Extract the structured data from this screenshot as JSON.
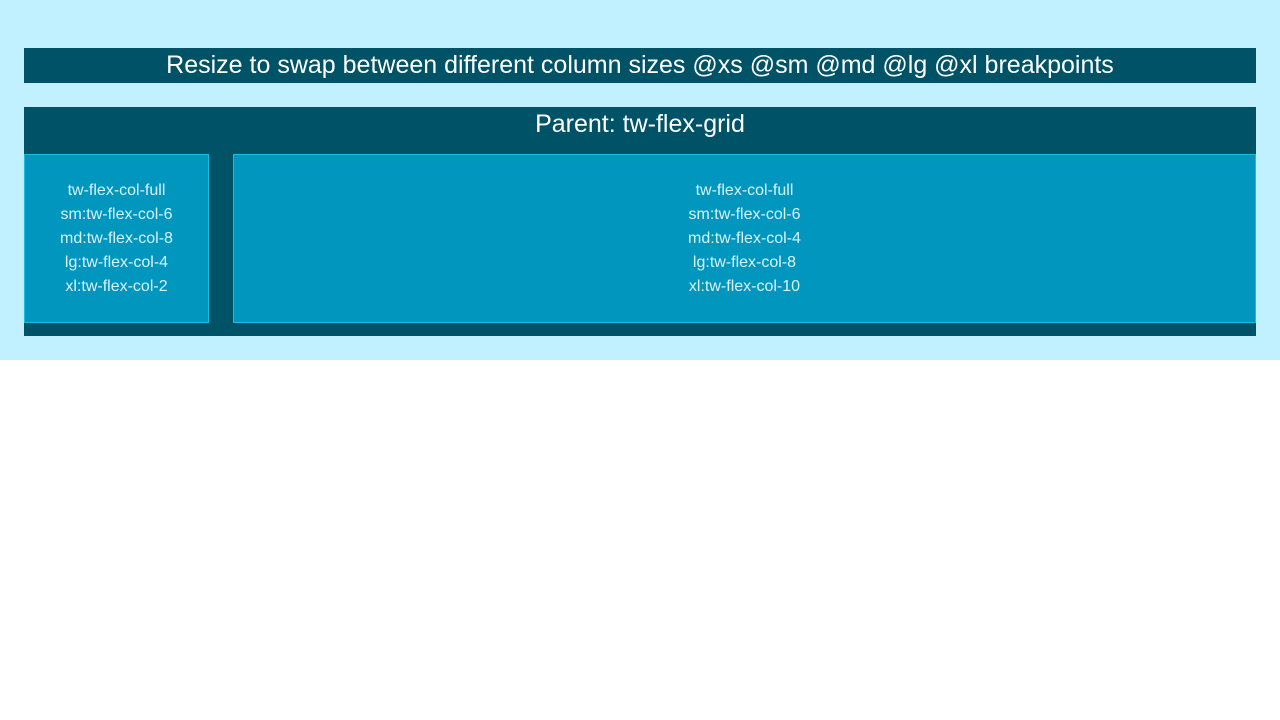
{
  "banner": {
    "text": "Resize to swap between different column sizes @xs @sm @md @lg @xl breakpoints"
  },
  "grid": {
    "title": "Parent: tw-flex-grid",
    "columns": [
      {
        "lines": [
          "tw-flex-col-full",
          "sm:tw-flex-col-6",
          "md:tw-flex-col-8",
          "lg:tw-flex-col-4",
          "xl:tw-flex-col-2"
        ]
      },
      {
        "lines": [
          "tw-flex-col-full",
          "sm:tw-flex-col-6",
          "md:tw-flex-col-4",
          "lg:tw-flex-col-8",
          "xl:tw-flex-col-10"
        ]
      }
    ]
  },
  "colors": {
    "page_background": "#c1f1fe",
    "dark_teal": "#005266",
    "column_blue": "#0096be",
    "column_border": "#16bde5"
  }
}
